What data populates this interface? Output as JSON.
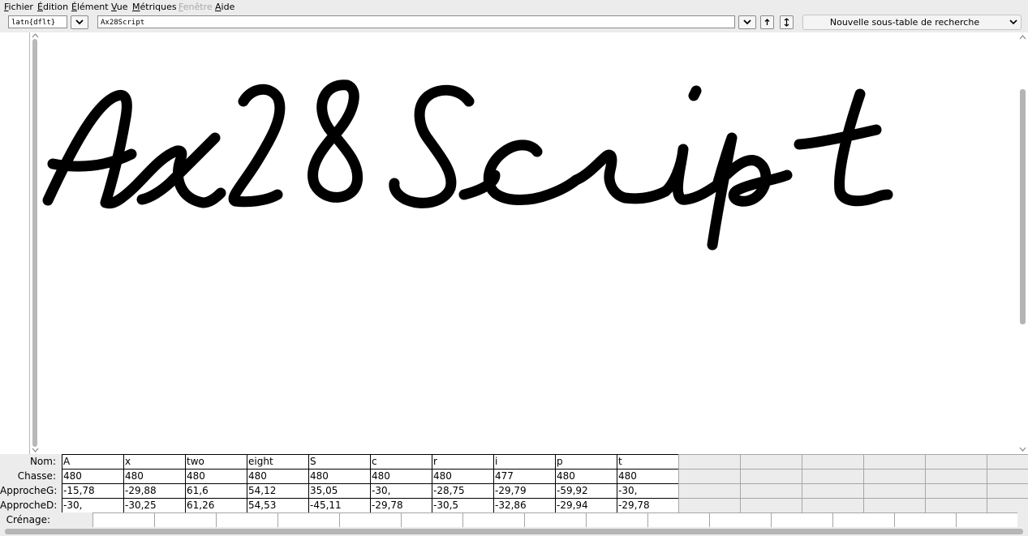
{
  "menu": [
    {
      "pre": "",
      "u": "F",
      "post": "ichier",
      "disabled": false
    },
    {
      "pre": "",
      "u": "É",
      "post": "dition",
      "disabled": false
    },
    {
      "pre": "",
      "u": "É",
      "post": "lément",
      "disabled": false
    },
    {
      "pre": "",
      "u": "V",
      "post": "ue",
      "disabled": false
    },
    {
      "pre": "",
      "u": "M",
      "post": "étriques",
      "disabled": false
    },
    {
      "pre": "",
      "u": "F",
      "post": "enêtre",
      "disabled": true
    },
    {
      "pre": "",
      "u": "A",
      "post": "ide",
      "disabled": false
    }
  ],
  "toolbar": {
    "script_value": "latn{dflt}",
    "text_value": "Ax28Script",
    "lookup_label": "Nouvelle sous-table de recherche"
  },
  "icons": {
    "dropdown": "chevron-down-icon",
    "up": "arrow-up-icon",
    "both": "arrows-up-down-icon"
  },
  "preview": {
    "text": "Ax28Script",
    "ink": "#000000"
  },
  "metrics": {
    "labels": {
      "name": "Nom:",
      "width": "Chasse:",
      "lsb": "ApprocheG:",
      "rsb": "ApprocheD:",
      "kern": "Crénage:"
    },
    "glyphs": [
      {
        "name": "A",
        "width": "480",
        "lsb": "-15,78",
        "rsb": "-30,"
      },
      {
        "name": "x",
        "width": "480",
        "lsb": "-29,88",
        "rsb": "-30,25"
      },
      {
        "name": "two",
        "width": "480",
        "lsb": "61,6",
        "rsb": "61,26"
      },
      {
        "name": "eight",
        "width": "480",
        "lsb": "54,12",
        "rsb": "54,53"
      },
      {
        "name": "S",
        "width": "480",
        "lsb": "35,05",
        "rsb": "-45,11"
      },
      {
        "name": "c",
        "width": "480",
        "lsb": "-30,",
        "rsb": "-29,78"
      },
      {
        "name": "r",
        "width": "480",
        "lsb": "-28,75",
        "rsb": "-30,5"
      },
      {
        "name": "i",
        "width": "477",
        "lsb": "-29,79",
        "rsb": "-32,86"
      },
      {
        "name": "p",
        "width": "480",
        "lsb": "-59,92",
        "rsb": "-29,94"
      },
      {
        "name": "t",
        "width": "480",
        "lsb": "-30,",
        "rsb": "-29,78"
      }
    ]
  }
}
